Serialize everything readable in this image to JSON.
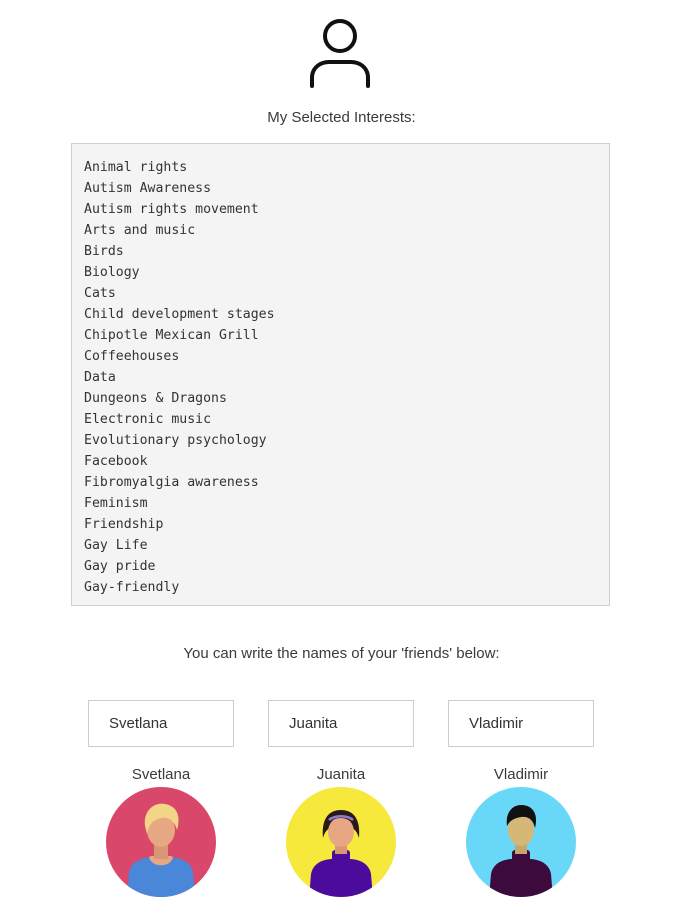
{
  "profile": {
    "icon": "user-icon"
  },
  "interests": {
    "heading": "My Selected Interests:",
    "items": [
      "Animal rights",
      "Autism Awareness",
      "Autism rights movement",
      "Arts and music",
      "Birds",
      "Biology",
      "Cats",
      "Child development stages",
      "Chipotle Mexican Grill",
      "Coffeehouses",
      "Data",
      "Dungeons & Dragons",
      "Electronic music",
      "Evolutionary psychology",
      "Facebook",
      "Fibromyalgia awareness",
      "Feminism",
      "Friendship",
      "Gay Life",
      "Gay pride",
      "Gay-friendly"
    ]
  },
  "friends": {
    "heading": "You can write the names of your 'friends' below:",
    "list": [
      {
        "input_value": "Svetlana",
        "name": "Svetlana",
        "avatar": "woman-blonde-avatar",
        "circle_color": "#d9486a"
      },
      {
        "input_value": "Juanita",
        "name": "Juanita",
        "avatar": "woman-dark-hair-avatar",
        "circle_color": "#f7e83c"
      },
      {
        "input_value": "Vladimir",
        "name": "Vladimir",
        "avatar": "man-dark-hair-avatar",
        "circle_color": "#69d7f7"
      }
    ]
  }
}
